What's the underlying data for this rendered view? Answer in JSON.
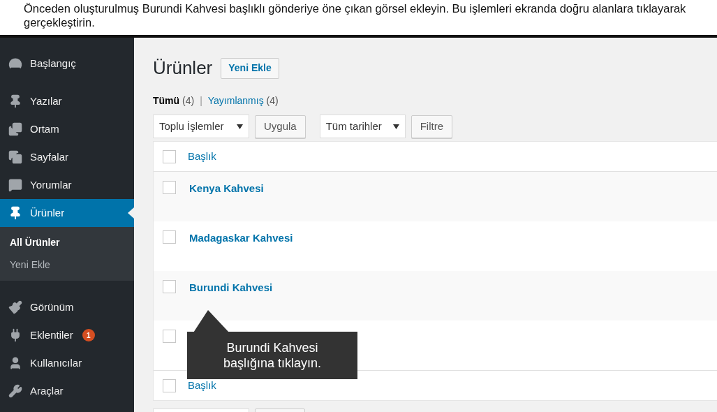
{
  "instruction": "Önceden oluşturulmuş Burundi Kahvesi başlıklı gönderiye öne çıkan görsel ekleyin. Bu işlemleri ekranda doğru alanlara tıklayarak gerçekleştirin.",
  "sidebar": {
    "items": [
      {
        "kind": "dashboard",
        "label": "Başlangıç",
        "selected": false
      },
      {
        "kind": "posts",
        "label": "Yazılar",
        "selected": false
      },
      {
        "kind": "media",
        "label": "Ortam",
        "selected": false
      },
      {
        "kind": "pages",
        "label": "Sayfalar",
        "selected": false
      },
      {
        "kind": "comments",
        "label": "Yorumlar",
        "selected": false
      },
      {
        "kind": "products",
        "label": "Ürünler",
        "selected": true,
        "children": [
          {
            "label": "All Ürünler",
            "selected": true
          },
          {
            "label": "Yeni Ekle",
            "selected": false
          }
        ]
      },
      {
        "kind": "appearance",
        "label": "Görünüm",
        "selected": false
      },
      {
        "kind": "plugins",
        "label": "Eklentiler",
        "selected": false,
        "badge": "1"
      },
      {
        "kind": "users",
        "label": "Kullanıcılar",
        "selected": false
      },
      {
        "kind": "tools",
        "label": "Araçlar",
        "selected": false
      }
    ]
  },
  "page": {
    "title": "Ürünler",
    "add_new": "Yeni Ekle",
    "filters": [
      {
        "label": "Tümü",
        "count": "(4)",
        "selected": true
      },
      {
        "label": "Yayımlanmış",
        "count": "(4)",
        "selected": false
      }
    ],
    "separator": "|",
    "bulk_select": "Toplu İşlemler",
    "apply": "Uygula",
    "date_select": "Tüm tarihler",
    "filter": "Filtre"
  },
  "table": {
    "column": "Başlık",
    "rows": [
      {
        "title": "Kenya Kahvesi",
        "checked": false
      },
      {
        "title": "Madagaskar Kahvesi",
        "checked": false
      },
      {
        "title": "Burundi Kahvesi",
        "checked": false
      },
      {
        "checked": false
      }
    ],
    "footer_column": "Başlık"
  },
  "tooltip": {
    "text": "Burundi Kahvesi başlığına tıklayın."
  }
}
